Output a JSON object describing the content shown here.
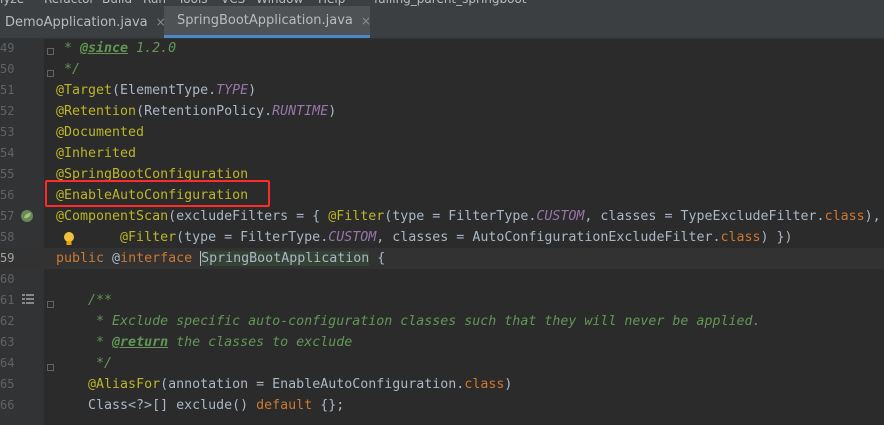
{
  "menu": [
    "lyze",
    "Refactor",
    "Build",
    "Run",
    "Tools",
    "VCS",
    "Window",
    "Help",
    "falling_parent_springboot"
  ],
  "tabs": [
    {
      "label": "DemoApplication.java",
      "active": false,
      "icon_color": "#3592c4"
    },
    {
      "label": "SpringBootApplication.java",
      "active": true,
      "icon_color": "#6a8759"
    }
  ],
  "close_glyph": "×",
  "lines": [
    {
      "num": "49",
      "tokens": [
        {
          "t": " * ",
          "c": "doc"
        },
        {
          "t": "@since",
          "c": "doctag"
        },
        {
          "t": " 1.2.0",
          "c": "doc"
        }
      ]
    },
    {
      "num": "50",
      "tokens": [
        {
          "t": " */",
          "c": "doc"
        }
      ]
    },
    {
      "num": "51",
      "tokens": [
        {
          "t": "@Target",
          "c": "ann"
        },
        {
          "t": "(ElementType."
        },
        {
          "t": "TYPE",
          "c": "it"
        },
        {
          "t": ")"
        }
      ]
    },
    {
      "num": "52",
      "tokens": [
        {
          "t": "@Retention",
          "c": "ann"
        },
        {
          "t": "(RetentionPolicy."
        },
        {
          "t": "RUNTIME",
          "c": "it"
        },
        {
          "t": ")"
        }
      ]
    },
    {
      "num": "53",
      "tokens": [
        {
          "t": "@Documented",
          "c": "ann"
        }
      ]
    },
    {
      "num": "54",
      "tokens": [
        {
          "t": "@Inherited",
          "c": "ann"
        }
      ]
    },
    {
      "num": "55",
      "tokens": [
        {
          "t": "@SpringBootConfiguration",
          "c": "ann"
        }
      ]
    },
    {
      "num": "56",
      "tokens": [
        {
          "t": "@EnableAutoConfiguration",
          "c": "ann"
        }
      ]
    },
    {
      "num": "57",
      "tokens": [
        {
          "t": "@ComponentScan",
          "c": "ann"
        },
        {
          "t": "(excludeFilters = { "
        },
        {
          "t": "@Filter",
          "c": "ann"
        },
        {
          "t": "(type = FilterType."
        },
        {
          "t": "CUSTOM",
          "c": "it"
        },
        {
          "t": ", classes = TypeExcludeFilter."
        },
        {
          "t": "class",
          "c": "kw"
        },
        {
          "t": "),"
        }
      ]
    },
    {
      "num": "58",
      "tokens": [
        {
          "t": "        "
        },
        {
          "t": "@Filter",
          "c": "ann"
        },
        {
          "t": "(type = FilterType."
        },
        {
          "t": "CUSTOM",
          "c": "it"
        },
        {
          "t": ", classes = AutoConfigurationExcludeFilter."
        },
        {
          "t": "class",
          "c": "kw"
        },
        {
          "t": ") })"
        }
      ]
    },
    {
      "num": "59",
      "current": true,
      "tokens": [
        {
          "t": "public",
          "c": "kw"
        },
        {
          "t": " @"
        },
        {
          "t": "interface",
          "c": "kw"
        },
        {
          "t": " "
        },
        {
          "t": "|",
          "c": "caret"
        },
        {
          "t": "SpringBootApplication",
          "c": "hl"
        },
        {
          "t": " {"
        }
      ]
    },
    {
      "num": "60",
      "tokens": []
    },
    {
      "num": "61",
      "tokens": [
        {
          "t": "    /**",
          "c": "doc"
        }
      ]
    },
    {
      "num": "62",
      "tokens": [
        {
          "t": "     * Exclude specific auto-configuration classes such that they will never be applied.",
          "c": "doc"
        }
      ]
    },
    {
      "num": "63",
      "tokens": [
        {
          "t": "     * ",
          "c": "doc"
        },
        {
          "t": "@return",
          "c": "doctag"
        },
        {
          "t": " the classes to exclude",
          "c": "doc"
        }
      ]
    },
    {
      "num": "64",
      "tokens": [
        {
          "t": "     */",
          "c": "doc"
        }
      ]
    },
    {
      "num": "65",
      "tokens": [
        {
          "t": "    "
        },
        {
          "t": "@AliasFor",
          "c": "ann"
        },
        {
          "t": "(annotation = EnableAutoConfiguration."
        },
        {
          "t": "class",
          "c": "kw"
        },
        {
          "t": ")"
        }
      ]
    },
    {
      "num": "66",
      "tokens": [
        {
          "t": "    Class<?>[] exclude() "
        },
        {
          "t": "default",
          "c": "kw"
        },
        {
          "t": " {};"
        }
      ]
    }
  ]
}
